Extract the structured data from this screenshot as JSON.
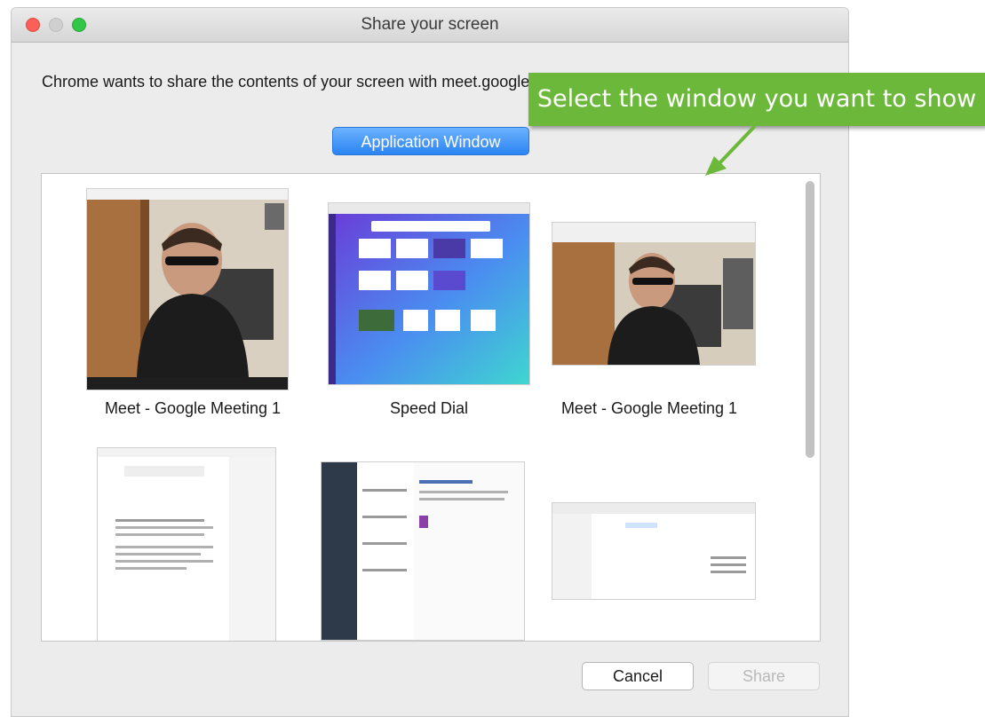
{
  "window": {
    "title": "Share your screen"
  },
  "prompt": {
    "text": "Chrome wants to share the contents of your screen with meet.google.com. Choose what you'd like to share."
  },
  "tabs": {
    "active_label": "Application Window"
  },
  "thumbnails": [
    {
      "label": "Meet - Google Meeting 1"
    },
    {
      "label": "Speed Dial"
    },
    {
      "label": "Meet - Google Meeting 1"
    },
    {
      "label": ""
    },
    {
      "label": ""
    },
    {
      "label": ""
    }
  ],
  "callout": {
    "text": "Select the window you want to show"
  },
  "buttons": {
    "cancel": "Cancel",
    "share": "Share"
  },
  "colors": {
    "accent": "#2a84f2",
    "callout": "#6cb83a",
    "close": "#fc5f57",
    "maximize": "#33c748"
  }
}
